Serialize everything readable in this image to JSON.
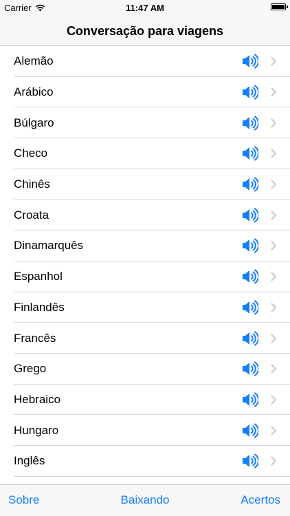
{
  "status_bar": {
    "carrier": "Carrier",
    "time": "11:47 AM",
    "battery_level": 1.0
  },
  "nav": {
    "title": "Conversação para viagens"
  },
  "languages": [
    {
      "label": "Alemão"
    },
    {
      "label": "Arábico"
    },
    {
      "label": "Búlgaro"
    },
    {
      "label": "Checo"
    },
    {
      "label": "Chinês"
    },
    {
      "label": "Croata"
    },
    {
      "label": "Dinamarquês"
    },
    {
      "label": "Espanhol"
    },
    {
      "label": "Finlandês"
    },
    {
      "label": "Francês"
    },
    {
      "label": "Grego"
    },
    {
      "label": "Hebraico"
    },
    {
      "label": "Hungaro"
    },
    {
      "label": "Inglês"
    },
    {
      "label": ""
    }
  ],
  "tab_bar": {
    "left": "Sobre",
    "center": "Baixando",
    "right": "Acertos"
  },
  "colors": {
    "accent": "#147efb",
    "chevron": "#c7c7cc"
  }
}
